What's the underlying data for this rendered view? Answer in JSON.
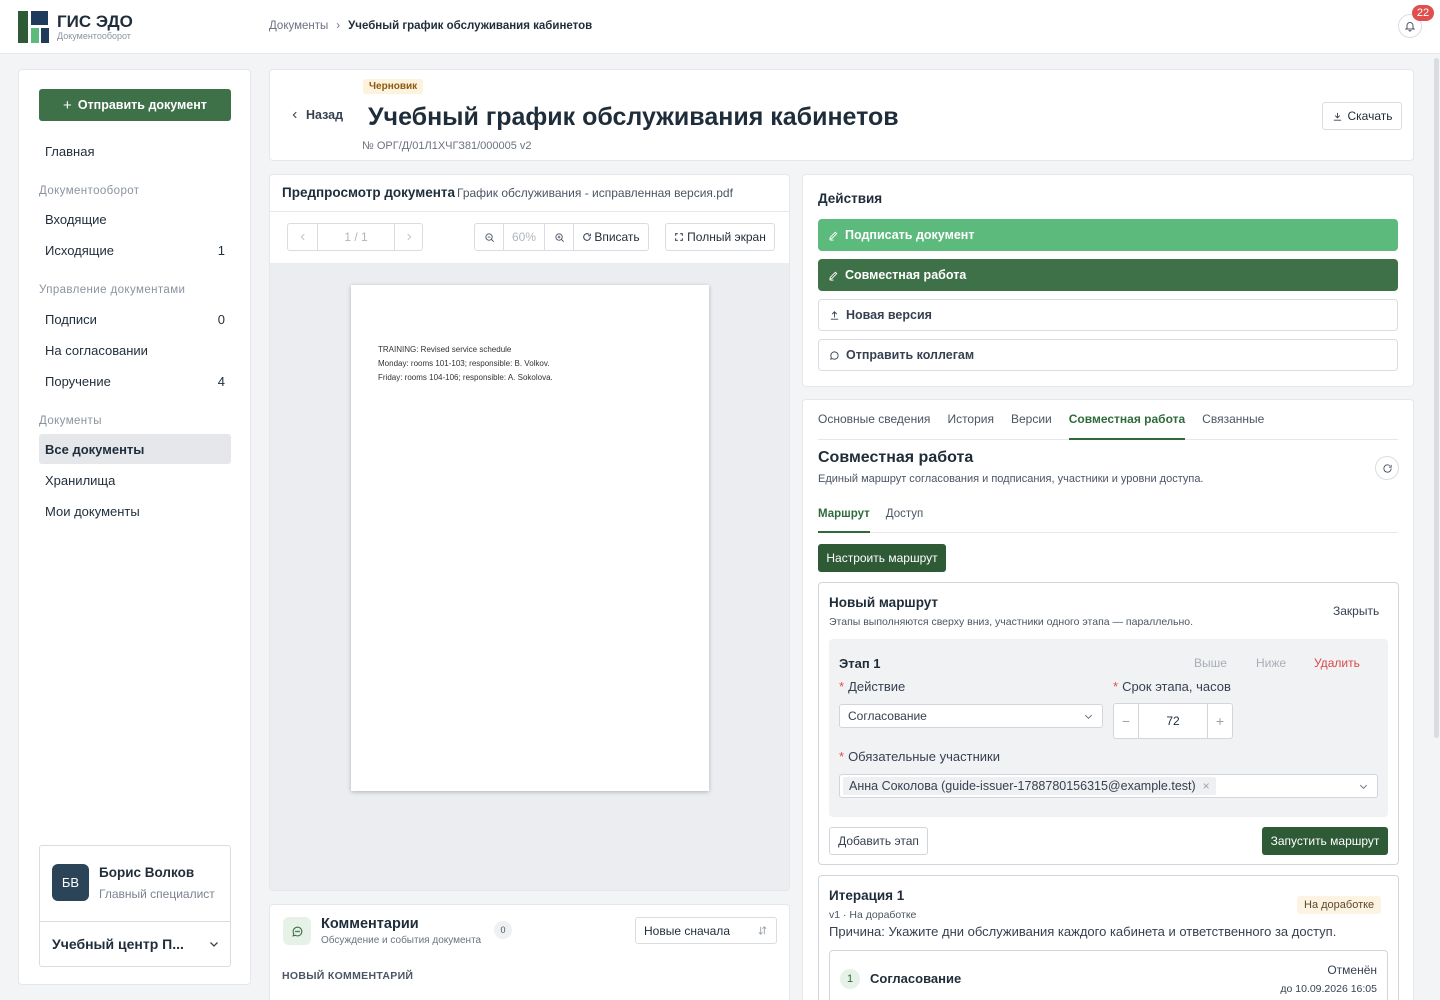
{
  "header": {
    "app_title": "ГИС ЭДО",
    "app_subtitle": "Документооборот",
    "breadcrumb_root": "Документы",
    "breadcrumb_sep": "›",
    "breadcrumb_current": "Учебный график обслуживания кабинетов",
    "notifications_count": "22"
  },
  "sidebar": {
    "send_button": "Отправить документ",
    "home": "Главная",
    "sec_docflow": "Документооборот",
    "incoming": "Входящие",
    "outgoing": "Исходящие",
    "outgoing_count": "1",
    "sec_management": "Управление документами",
    "signatures": "Подписи",
    "signatures_count": "0",
    "approval": "На согласовании",
    "assignment": "Поручение",
    "assignment_count": "4",
    "sec_documents": "Документы",
    "all_docs": "Все документы",
    "storages": "Хранилища",
    "my_docs": "Мои документы",
    "user": {
      "initials": "БВ",
      "name": "Борис Волков",
      "role": "Главный специалист",
      "org": "Учебный центр П..."
    }
  },
  "document": {
    "status": "Черновик",
    "back_label": "Назад",
    "title": "Учебный график обслуживания кабинетов",
    "number": "№ ОРГ/Д/01Л1ХЧГЗ81/000005  v2",
    "download_label": "Скачать"
  },
  "preview": {
    "heading": "Предпросмотр документа",
    "filename": "График обслуживания - исправленная версия.pdf",
    "page_indicator": "1 / 1",
    "zoom": "60%",
    "fit_label": "Вписать",
    "fullscreen_label": "Полный экран",
    "page_lines": [
      "TRAINING: Revised service schedule",
      "Monday: rooms 101-103; responsible: B. Volkov.",
      "Friday: rooms 104-106; responsible: A. Sokolova."
    ]
  },
  "comments": {
    "title": "Комментарии",
    "subtitle": "Обсуждение и события документа",
    "count": "0",
    "sort": "Новые сначала",
    "new_label": "НОВЫЙ КОММЕНТАРИЙ"
  },
  "actions": {
    "title": "Действия",
    "sign": "Подписать документ",
    "collab": "Совместная работа",
    "new_version": "Новая версия",
    "send_colleagues": "Отправить коллегам",
    "colors": {
      "sign": "#5dba7d",
      "collab": "#3e7148"
    }
  },
  "collab": {
    "tabs": [
      "Основные сведения",
      "История",
      "Версии",
      "Совместная работа",
      "Связанные"
    ],
    "heading": "Совместная работа",
    "subheading": "Единый маршрут согласования и подписания, участники и уровни доступа.",
    "subtabs": [
      "Маршрут",
      "Доступ"
    ],
    "configure_label": "Настроить маршрут",
    "route": {
      "title": "Новый маршрут",
      "subtitle": "Этапы выполняются сверху вниз, участники одного этапа — параллельно.",
      "close_label": "Закрыть",
      "stage_title": "Этап 1",
      "up_label": "Выше",
      "down_label": "Ниже",
      "delete_label": "Удалить",
      "action_label": "Действие",
      "action_value": "Согласование",
      "deadline_label": "Срок этапа, часов",
      "deadline_value": "72",
      "participants_label": "Обязательные участники",
      "participant": "Анна Соколова (guide-issuer-1788780156315@example.test)",
      "add_stage_label": "Добавить этап",
      "run_label": "Запустить маршрут"
    },
    "iteration": {
      "title": "Итерация 1",
      "meta": "v1 · На доработке",
      "reason": "Причина: Укажите дни обслуживания каждого кабинета и ответственного за доступ.",
      "badge": "На доработке",
      "step_number": "1",
      "step_title": "Согласование",
      "step_status": "Отменён",
      "step_due": "до 10.09.2026 16:05"
    }
  }
}
